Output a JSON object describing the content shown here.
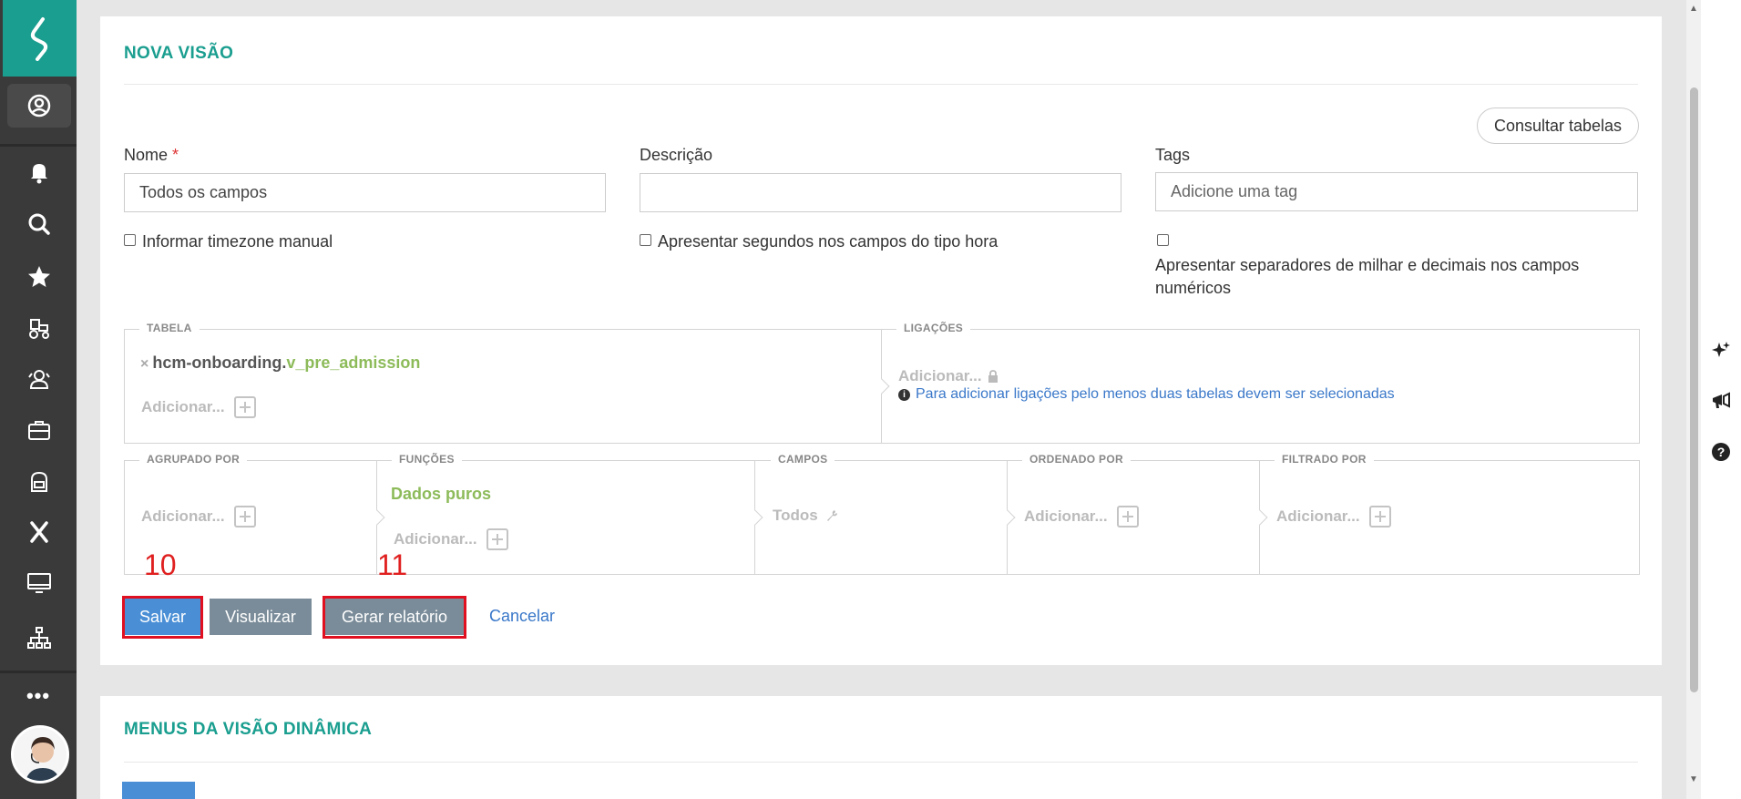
{
  "sidebar": {
    "icons": [
      "logo-icon",
      "user-circle-icon",
      "bell-icon",
      "search-icon",
      "star-icon",
      "tractor-icon",
      "users-group-icon",
      "briefcase-icon",
      "backpack-icon",
      "x-tools-icon",
      "monitor-icon",
      "org-chart-icon"
    ],
    "more_label": "•••"
  },
  "card": {
    "title": "NOVA VISÃO",
    "consult_button": "Consultar tabelas",
    "nome_label": "Nome",
    "required_mark": "*",
    "nome_value": "Todos os campos",
    "descricao_label": "Descrição",
    "descricao_value": "",
    "tags_label": "Tags",
    "tags_placeholder": "Adicione uma tag",
    "chk_timezone": "Informar timezone manual",
    "chk_seconds": "Apresentar segundos nos campos do tipo hora",
    "chk_separators_line1": "Apresentar separadores de milhar e decimais nos campos",
    "chk_separators_line2": "numéricos"
  },
  "builder": {
    "tabela_legend": "TABELA",
    "table_prefix": "hcm-onboarding.",
    "table_name": "v_pre_admission",
    "table_remove": "×",
    "add_label": "Adicionar...",
    "ligacoes_legend": "LIGAÇÕES",
    "ligacoes_info": "Para adicionar ligações pelo menos duas tabelas devem ser selecionadas",
    "agrupado_legend": "AGRUPADO POR",
    "funcoes_legend": "FUNÇÕES",
    "funcoes_value": "Dados puros",
    "campos_legend": "CAMPOS",
    "campos_value": "Todos",
    "ordenado_legend": "ORDENADO POR",
    "filtrado_legend": "FILTRADO POR"
  },
  "annotations": {
    "mark_10": "10",
    "mark_11": "11"
  },
  "actions": {
    "save": "Salvar",
    "preview": "Visualizar",
    "report": "Gerar relatório",
    "cancel": "Cancelar"
  },
  "card2": {
    "title": "MENUS DA VISÃO DINÂMICA"
  },
  "colors": {
    "accent": "#1a9e8f",
    "primary": "#4a8fd6",
    "grey_button": "#7a8c99",
    "highlight": "#e01020",
    "green": "#8dbb5a"
  }
}
